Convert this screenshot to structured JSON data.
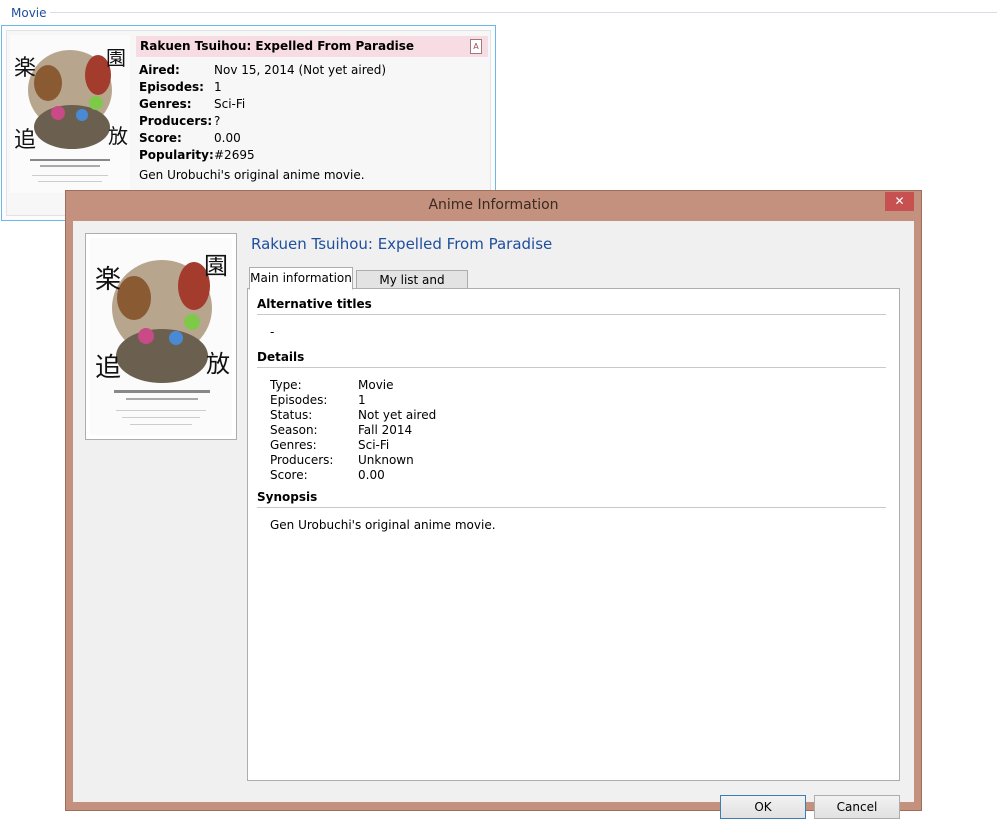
{
  "group": {
    "label": "Movie"
  },
  "card": {
    "title": "Rakuen Tsuihou: Expelled From Paradise",
    "icon": "A",
    "rows": [
      {
        "key": "Aired:",
        "value": "Nov 15, 2014 (Not yet aired)"
      },
      {
        "key": "Episodes:",
        "value": "1"
      },
      {
        "key": "Genres:",
        "value": "Sci-Fi"
      },
      {
        "key": "Producers:",
        "value": "?"
      },
      {
        "key": "Score:",
        "value": "0.00"
      },
      {
        "key": "Popularity:",
        "value": "#2695"
      }
    ],
    "synopsis": "Gen Urobuchi's original anime movie."
  },
  "dialog": {
    "title": "Anime Information",
    "close": "✕",
    "anime_title": "Rakuen Tsuihou: Expelled From Paradise",
    "tabs": [
      "Main information",
      "My list and settings"
    ],
    "sections": {
      "alt_titles": "Alternative titles",
      "alt_value": "-",
      "details": "Details",
      "synopsis": "Synopsis"
    },
    "details": [
      {
        "key": "Type:",
        "value": "Movie"
      },
      {
        "key": "Episodes:",
        "value": "1"
      },
      {
        "key": "Status:",
        "value": "Not yet aired"
      },
      {
        "key": "Season:",
        "value": "Fall 2014"
      },
      {
        "key": "Genres:",
        "value": "Sci-Fi"
      },
      {
        "key": "Producers:",
        "value": "Unknown"
      },
      {
        "key": "Score:",
        "value": "0.00"
      }
    ],
    "synopsis_text": "Gen Urobuchi's original anime movie.",
    "ok": "OK",
    "cancel": "Cancel"
  },
  "colors": {
    "accent": "#1e4e9c",
    "dialog_frame": "#c4917e",
    "close": "#c75050"
  }
}
